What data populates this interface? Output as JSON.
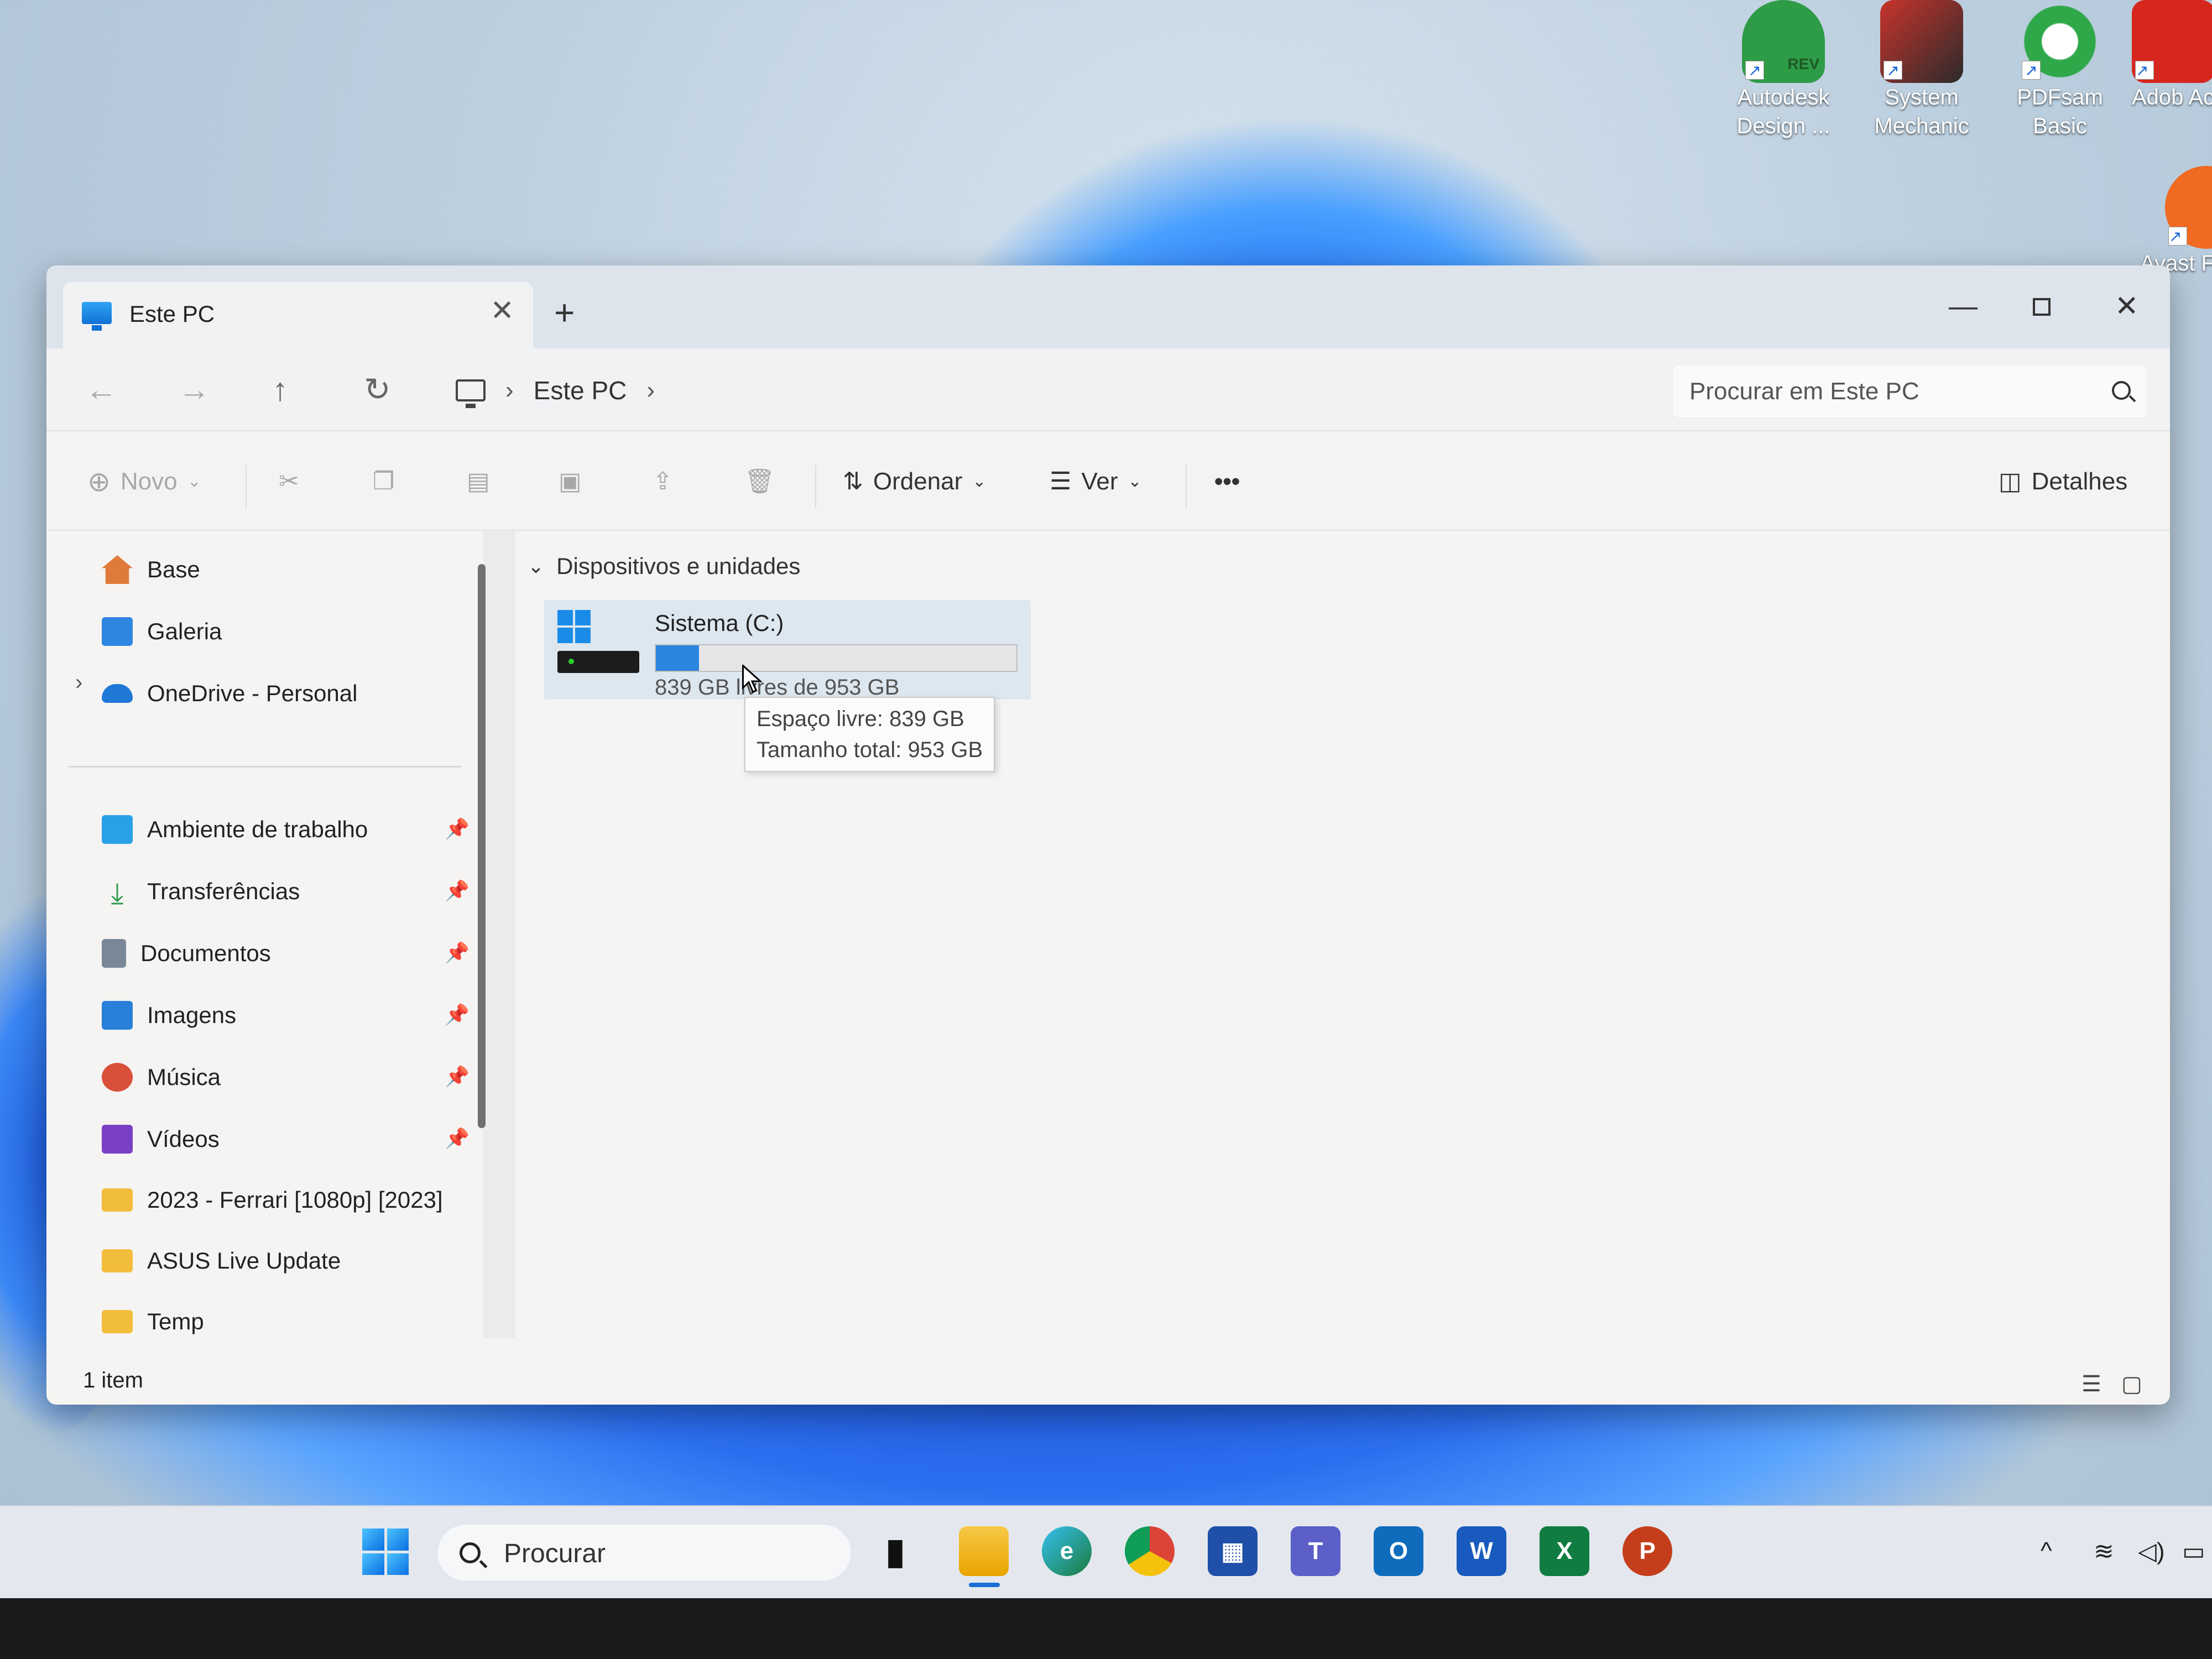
{
  "desktop": {
    "icons": [
      {
        "label": "Autodesk Design ...",
        "icon": "autodesk-design-review-icon"
      },
      {
        "label": "System Mechanic",
        "icon": "system-mechanic-icon"
      },
      {
        "label": "PDFsam Basic",
        "icon": "pdfsam-icon"
      },
      {
        "label": "Adob Acrob",
        "icon": "adobe-acrobat-icon"
      },
      {
        "label": "Avast F ntivi",
        "icon": "avast-icon"
      }
    ],
    "autodesk_badge": "REV"
  },
  "window": {
    "tab_title": "Este PC",
    "tab_close": "✕",
    "new_tab": "+",
    "controls": {
      "minimize": "—",
      "close": "✕"
    }
  },
  "nav": {
    "back": "←",
    "forward": "→",
    "up": "↑",
    "refresh": "↻",
    "breadcrumb": [
      "Este PC"
    ],
    "sep": "›",
    "search_placeholder": "Procurar em Este PC"
  },
  "commands": {
    "new_label": "Novo",
    "sort_label": "Ordenar",
    "view_label": "Ver",
    "more": "•••",
    "details_label": "Detalhes",
    "chevron": "⌄"
  },
  "sidebar": {
    "top_items": [
      {
        "label": "Base",
        "icon": "home-icon",
        "color": "#e07a3a"
      },
      {
        "label": "Galeria",
        "icon": "gallery-icon",
        "color": "#2f86e0"
      },
      {
        "label": "OneDrive - Personal",
        "icon": "onedrive-cloud-icon",
        "color": "#1f78d6"
      }
    ],
    "pinned_items": [
      {
        "label": "Ambiente de trabalho",
        "icon": "desktop-folder-icon",
        "color": "#2aa0e8",
        "pinned": true
      },
      {
        "label": "Transferências",
        "icon": "download-icon",
        "color": "#2f9a4a",
        "pinned": true
      },
      {
        "label": "Documentos",
        "icon": "documents-icon",
        "color": "#7a8796",
        "pinned": true
      },
      {
        "label": "Imagens",
        "icon": "pictures-icon",
        "color": "#2a7fd8",
        "pinned": true
      },
      {
        "label": "Música",
        "icon": "music-icon",
        "color": "#d9503a",
        "pinned": true
      },
      {
        "label": "Vídeos",
        "icon": "videos-icon",
        "color": "#7a3fc4",
        "pinned": true
      },
      {
        "label": "2023 - Ferrari [1080p] [2023]",
        "icon": "folder-icon",
        "color": "#f3bd3c",
        "pinned": false
      },
      {
        "label": "ASUS Live Update",
        "icon": "folder-icon",
        "color": "#f3bd3c",
        "pinned": false
      },
      {
        "label": "Temp",
        "icon": "folder-icon",
        "color": "#f3bd3c",
        "pinned": false
      }
    ],
    "pin_glyph": "📌",
    "expand_glyph": "›"
  },
  "content": {
    "section_title": "Dispositivos e unidades",
    "section_chevron": "⌄",
    "drive": {
      "name": "Sistema (C:)",
      "free_text": "839 GB livres de 953 GB",
      "used_fraction": 0.12
    },
    "tooltip": {
      "line1": "Espaço livre: 839 GB",
      "line2": "Tamanho total: 953 GB"
    }
  },
  "status": {
    "item_count": "1 item"
  },
  "taskbar": {
    "search_placeholder": "Procurar",
    "apps": [
      {
        "name": "task-view",
        "glyph": "▮"
      },
      {
        "name": "file-explorer",
        "glyph": ""
      },
      {
        "name": "edge",
        "glyph": "e"
      },
      {
        "name": "chrome",
        "glyph": ""
      },
      {
        "name": "microsoft-store",
        "glyph": "▦"
      },
      {
        "name": "teams",
        "glyph": "T"
      },
      {
        "name": "outlook",
        "glyph": "O"
      },
      {
        "name": "word",
        "glyph": "W"
      },
      {
        "name": "excel",
        "glyph": "X"
      },
      {
        "name": "powerpoint",
        "glyph": "P"
      }
    ],
    "tray": {
      "chevron": "^",
      "wifi": "≋",
      "volume": "◁)",
      "battery": "▭"
    }
  }
}
